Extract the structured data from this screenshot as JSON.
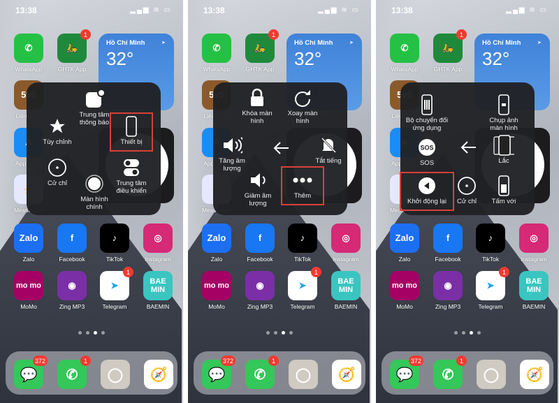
{
  "status": {
    "time": "13:38",
    "signal_icon": "signal-icon",
    "wifi_icon": "wifi-icon",
    "battery_icon": "battery-icon"
  },
  "widgets": {
    "weather": {
      "city": "Hồ Chí Minh",
      "temperature": "32°",
      "location_icon": "location-arrow-icon"
    }
  },
  "apps": [
    {
      "label": "WhatsApp",
      "color": "#25c145",
      "glyph": "✆"
    },
    {
      "label": "GHTK App",
      "color": "#1f8a3b",
      "glyph": "🛵",
      "badge": "1"
    },
    {
      "label": "LiênQuân",
      "color": "#8b5a2b",
      "glyph": "5v5"
    },
    {
      "label": "App Store",
      "color": "#1a8cf5",
      "glyph": "A"
    },
    {
      "label": "Messenger",
      "color": "#e6e8ff",
      "glyph": "⚡"
    },
    {
      "label": "Zalo",
      "color": "#1d6ff2",
      "glyph": "Zalo"
    },
    {
      "label": "Facebook",
      "color": "#1877f2",
      "glyph": "f"
    },
    {
      "label": "TikTok",
      "color": "#000000",
      "glyph": "♪"
    },
    {
      "label": "Instagram",
      "color": "#d62976",
      "glyph": "◎"
    },
    {
      "label": "MoMo",
      "color": "#a50064",
      "glyph": "mo mo"
    },
    {
      "label": "Zing MP3",
      "color": "#7b2fa6",
      "glyph": "◉"
    },
    {
      "label": "Telegram",
      "color": "#ffffff",
      "glyph": "➤",
      "badge": "1"
    },
    {
      "label": "BAEMIN",
      "color": "#3ac5c0",
      "glyph": "BAE MIN"
    }
  ],
  "dock": [
    {
      "name": "messages",
      "color": "#34c759",
      "glyph": "💬",
      "badge": "372"
    },
    {
      "name": "phone",
      "color": "#34c759",
      "glyph": "✆",
      "badge": "1"
    },
    {
      "name": "contacts",
      "color": "#cfcac2",
      "glyph": "◯"
    },
    {
      "name": "safari",
      "color": "#ffffff",
      "glyph": "🧭"
    }
  ],
  "page_dots": {
    "count": 4,
    "active": 2
  },
  "accent_highlight": "#d9403a",
  "panels": [
    {
      "items": [
        {
          "label": "Trung tâm thông báo",
          "icon": "notification-center-icon",
          "pos": "top"
        },
        {
          "label": "Tùy chỉnh",
          "icon": "star-icon",
          "pos": "left"
        },
        {
          "label": "Thiết bị",
          "icon": "device-icon",
          "pos": "right",
          "highlighted": true
        },
        {
          "label": "Cử chỉ",
          "icon": "gesture-icon",
          "pos": "bottom-left"
        },
        {
          "label": "Màn hình chính",
          "icon": "home-button-icon",
          "pos": "bottom"
        },
        {
          "label": "Trung tâm điều khiển",
          "icon": "control-center-icon",
          "pos": "bottom-right"
        }
      ]
    },
    {
      "items": [
        {
          "label": "Khóa màn hình",
          "icon": "lock-icon",
          "pos": "top-left"
        },
        {
          "label": "Xoay màn hình",
          "icon": "rotate-icon",
          "pos": "top-right"
        },
        {
          "label": "Tăng âm lượng",
          "icon": "volume-up-icon",
          "pos": "left"
        },
        {
          "label": "",
          "icon": "back-arrow-icon",
          "pos": "center"
        },
        {
          "label": "Tắt tiếng",
          "icon": "mute-icon",
          "pos": "right"
        },
        {
          "label": "Giảm âm lượng",
          "icon": "volume-down-icon",
          "pos": "bottom-left"
        },
        {
          "label": "Thêm",
          "icon": "more-icon",
          "pos": "bottom-right",
          "highlighted": true
        }
      ]
    },
    {
      "items": [
        {
          "label": "Bộ chuyển đổi ứng dụng",
          "icon": "app-switcher-icon",
          "pos": "top-left"
        },
        {
          "label": "Chụp ảnh màn hình",
          "icon": "screenshot-icon",
          "pos": "top-right"
        },
        {
          "label": "SOS",
          "icon": "sos-icon",
          "pos": "left"
        },
        {
          "label": "",
          "icon": "back-arrow-icon",
          "pos": "center"
        },
        {
          "label": "Lắc",
          "icon": "shake-icon",
          "pos": "right"
        },
        {
          "label": "Khởi động lại",
          "icon": "restart-icon",
          "pos": "bottom-left",
          "highlighted": true
        },
        {
          "label": "Cử chỉ",
          "icon": "gesture-icon",
          "pos": "bottom"
        },
        {
          "label": "Tấm với",
          "icon": "reachability-icon",
          "pos": "bottom-right"
        }
      ]
    }
  ]
}
